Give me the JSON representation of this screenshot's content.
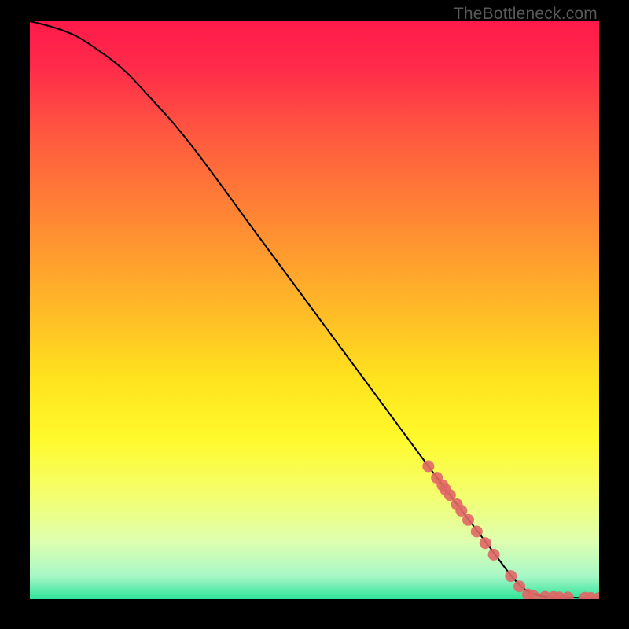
{
  "watermark": "TheBottleneck.com",
  "chart_data": {
    "type": "line",
    "title": "",
    "xlabel": "",
    "ylabel": "",
    "xlim": [
      0,
      100
    ],
    "ylim": [
      0,
      100
    ],
    "grid": false,
    "legend": false,
    "series": [
      {
        "name": "curve",
        "style": "line",
        "color": "#000000",
        "x": [
          0,
          4,
          8,
          12,
          16,
          20,
          28,
          40,
          55,
          70,
          80,
          86,
          90,
          94,
          98,
          100
        ],
        "y": [
          100,
          99,
          97.5,
          95,
          92,
          88,
          79,
          63,
          43,
          23,
          10,
          2.5,
          0.5,
          0.3,
          0.2,
          0.2
        ]
      },
      {
        "name": "dots",
        "style": "scatter",
        "color": "#e06666",
        "x": [
          70,
          71.5,
          72.5,
          73,
          73.8,
          75,
          75.8,
          77,
          78.5,
          80,
          81.5,
          84.5,
          86,
          87.5,
          88.5,
          90.5,
          92,
          93,
          94.5,
          97.5,
          98.5,
          100
        ],
        "y": [
          23,
          21,
          19.7,
          19,
          18,
          16.4,
          15.3,
          13.7,
          11.7,
          9.7,
          7.7,
          4,
          2.2,
          0.8,
          0.5,
          0.4,
          0.35,
          0.3,
          0.28,
          0.25,
          0.22,
          0.2
        ]
      }
    ],
    "background_gradient_stops": [
      {
        "t": 0.0,
        "color": "#ff1a4a"
      },
      {
        "t": 0.08,
        "color": "#ff2b4a"
      },
      {
        "t": 0.2,
        "color": "#ff5a3f"
      },
      {
        "t": 0.35,
        "color": "#ff8a33"
      },
      {
        "t": 0.5,
        "color": "#ffba27"
      },
      {
        "t": 0.62,
        "color": "#ffe31e"
      },
      {
        "t": 0.72,
        "color": "#fff92a"
      },
      {
        "t": 0.82,
        "color": "#f4ff6e"
      },
      {
        "t": 0.9,
        "color": "#deffb0"
      },
      {
        "t": 0.96,
        "color": "#a8f7c6"
      },
      {
        "t": 1.0,
        "color": "#2ee49a"
      }
    ]
  }
}
